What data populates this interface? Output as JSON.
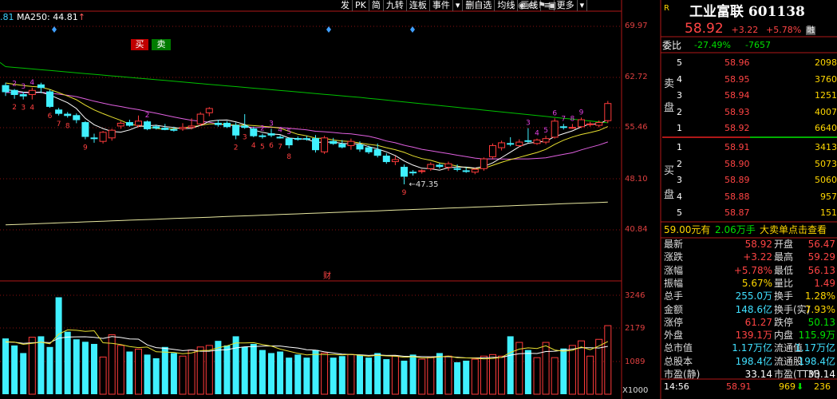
{
  "toolbar": {
    "items": [
      "发",
      "PK",
      "简",
      "九转",
      "连板",
      "事件",
      "▾",
      "删自选",
      "均线",
      "画线",
      "≡",
      "更多",
      "▾"
    ],
    "icons": [
      "search-icon",
      "eye-icon",
      "adjust-icon",
      "marker-icon",
      "save-icon"
    ]
  },
  "ma_legend": {
    "prefix": ".81",
    "ma250_label": "MA250: 44.81",
    "ma250_arrow": "↑"
  },
  "stock": {
    "r_mark": "R",
    "name": "工业富联 601138",
    "price": "58.92",
    "change": "+3.22",
    "change_pct": "+5.78%",
    "tag": "融"
  },
  "weibi": {
    "label": "委比",
    "ratio": "-27.49%",
    "diff": "-7657",
    "buy_btn": "买",
    "sell_btn": "卖"
  },
  "orderbook": {
    "sell_label_1": "卖",
    "sell_label_2": "盘",
    "buy_label_1": "买",
    "buy_label_2": "盘",
    "asks": [
      {
        "level": "5",
        "price": "58.96",
        "qty": "2098"
      },
      {
        "level": "4",
        "price": "58.95",
        "qty": "3760"
      },
      {
        "level": "3",
        "price": "58.94",
        "qty": "1251"
      },
      {
        "level": "2",
        "price": "58.93",
        "qty": "4007"
      },
      {
        "level": "1",
        "price": "58.92",
        "qty": "6640"
      }
    ],
    "bids": [
      {
        "level": "1",
        "price": "58.91",
        "qty": "3413"
      },
      {
        "level": "2",
        "price": "58.90",
        "qty": "5073"
      },
      {
        "level": "3",
        "price": "58.89",
        "qty": "5060"
      },
      {
        "level": "4",
        "price": "58.88",
        "qty": "957"
      },
      {
        "level": "5",
        "price": "58.87",
        "qty": "151"
      }
    ]
  },
  "big_order": {
    "price": "59.00元有",
    "qty": "2.06万手",
    "text": "大卖单点击查看"
  },
  "quotes": [
    {
      "l1": "最新",
      "v1": "58.92",
      "c1": "red",
      "l2": "开盘",
      "v2": "56.47",
      "c2": "red"
    },
    {
      "l1": "涨跌",
      "v1": "+3.22",
      "c1": "red",
      "l2": "最高",
      "v2": "59.29",
      "c2": "red"
    },
    {
      "l1": "涨幅",
      "v1": "+5.78%",
      "c1": "red",
      "l2": "最低",
      "v2": "56.13",
      "c2": "red"
    },
    {
      "l1": "振幅",
      "v1": "5.67%",
      "c1": "yellow",
      "l2": "量比",
      "v2": "1.49",
      "c2": "red"
    },
    {
      "l1": "总手",
      "v1": "255.0万",
      "c1": "cyan",
      "l2": "换手",
      "v2": "1.28%",
      "c2": "yellow"
    },
    {
      "l1": "金额",
      "v1": "148.6亿",
      "c1": "cyan",
      "l2": "换手(实)",
      "v2": "7.93%",
      "c2": "yellow"
    },
    {
      "l1": "涨停",
      "v1": "61.27",
      "c1": "red",
      "l2": "跌停",
      "v2": "50.13",
      "c2": "green"
    },
    {
      "l1": "外盘",
      "v1": "139.1万",
      "c1": "red",
      "l2": "内盘",
      "v2": "115.9万",
      "c2": "green"
    },
    {
      "l1": "总市值",
      "v1": "1.17万亿",
      "c1": "cyan",
      "l2": "流通值",
      "v2": "1.17万亿",
      "c2": "cyan"
    },
    {
      "l1": "总股本",
      "v1": "198.4亿",
      "c1": "cyan",
      "l2": "流通股",
      "v2": "198.4亿",
      "c2": "cyan"
    },
    {
      "l1": "市盈(静)",
      "v1": "33.14",
      "c1": "white",
      "l2": "市盈(TTM)",
      "v2": "33.14",
      "c2": "white"
    }
  ],
  "tick": {
    "time": "14:56",
    "price": "58.91",
    "qty": "969",
    "arrow": "⬇",
    "extra": "236"
  },
  "price_axis": [
    "69.97",
    "62.72",
    "55.46",
    "48.10",
    "40.84"
  ],
  "vol_axis": [
    "3246",
    "2179",
    "1089"
  ],
  "vol_unit": "X1000",
  "finance_mark": "财",
  "low_annotation": "←47.35",
  "chart_data": {
    "type": "candlestick",
    "price_ylim": [
      40.84,
      69.97
    ],
    "volume_ylim": [
      0,
      3246
    ],
    "candles": [
      {
        "o": 61.5,
        "h": 61.9,
        "l": 60.0,
        "c": 60.6
      },
      {
        "o": 60.8,
        "h": 61.0,
        "l": 59.6,
        "c": 60.2
      },
      {
        "o": 60.2,
        "h": 60.6,
        "l": 59.5,
        "c": 60.0
      },
      {
        "o": 60.2,
        "h": 61.2,
        "l": 59.5,
        "c": 60.8
      },
      {
        "o": 61.6,
        "h": 61.9,
        "l": 60.4,
        "c": 61.2
      },
      {
        "o": 60.6,
        "h": 60.9,
        "l": 58.3,
        "c": 58.5
      },
      {
        "o": 58.0,
        "h": 58.3,
        "l": 57.2,
        "c": 57.5
      },
      {
        "o": 57.4,
        "h": 57.7,
        "l": 56.9,
        "c": 57.2
      },
      {
        "o": 57.2,
        "h": 57.5,
        "l": 56.1,
        "c": 56.6
      },
      {
        "o": 56.2,
        "h": 56.4,
        "l": 53.8,
        "c": 54.2
      },
      {
        "o": 54.0,
        "h": 54.6,
        "l": 53.3,
        "c": 53.9
      },
      {
        "o": 53.5,
        "h": 55.0,
        "l": 53.2,
        "c": 54.8
      },
      {
        "o": 54.0,
        "h": 55.3,
        "l": 53.6,
        "c": 55.1
      },
      {
        "o": 55.7,
        "h": 56.4,
        "l": 55.3,
        "c": 56.1
      },
      {
        "o": 56.2,
        "h": 56.6,
        "l": 55.6,
        "c": 55.8
      },
      {
        "o": 55.8,
        "h": 57.2,
        "l": 55.5,
        "c": 56.4
      },
      {
        "o": 56.3,
        "h": 56.5,
        "l": 55.1,
        "c": 55.3
      },
      {
        "o": 55.6,
        "h": 55.9,
        "l": 55.2,
        "c": 55.4
      },
      {
        "o": 55.4,
        "h": 56.0,
        "l": 55.1,
        "c": 55.2
      },
      {
        "o": 55.2,
        "h": 55.6,
        "l": 54.9,
        "c": 55.1
      },
      {
        "o": 55.3,
        "h": 56.1,
        "l": 55.0,
        "c": 55.5
      },
      {
        "o": 55.5,
        "h": 56.8,
        "l": 55.2,
        "c": 55.7
      },
      {
        "o": 56.0,
        "h": 57.7,
        "l": 55.7,
        "c": 57.4
      },
      {
        "o": 57.6,
        "h": 58.4,
        "l": 57.1,
        "c": 58.2
      },
      {
        "o": 56.1,
        "h": 56.6,
        "l": 55.6,
        "c": 55.9
      },
      {
        "o": 56.1,
        "h": 56.4,
        "l": 55.4,
        "c": 55.6
      },
      {
        "o": 55.8,
        "h": 56.2,
        "l": 53.8,
        "c": 54.4
      },
      {
        "o": 55.7,
        "h": 57.4,
        "l": 55.3,
        "c": 55.5
      },
      {
        "o": 55.3,
        "h": 55.6,
        "l": 54.1,
        "c": 54.3
      },
      {
        "o": 54.3,
        "h": 54.6,
        "l": 53.9,
        "c": 54.2
      },
      {
        "o": 54.6,
        "h": 55.3,
        "l": 54.1,
        "c": 54.4
      },
      {
        "o": 54.1,
        "h": 54.4,
        "l": 53.9,
        "c": 54.0
      },
      {
        "o": 53.9,
        "h": 54.1,
        "l": 52.5,
        "c": 53.0
      },
      {
        "o": 53.9,
        "h": 54.2,
        "l": 53.6,
        "c": 53.8
      },
      {
        "o": 53.9,
        "h": 54.3,
        "l": 53.6,
        "c": 53.8
      },
      {
        "o": 53.9,
        "h": 54.4,
        "l": 51.9,
        "c": 52.3
      },
      {
        "o": 52.0,
        "h": 54.3,
        "l": 51.7,
        "c": 54.0
      },
      {
        "o": 53.5,
        "h": 54.0,
        "l": 53.0,
        "c": 53.2
      },
      {
        "o": 53.1,
        "h": 53.7,
        "l": 52.5,
        "c": 52.7
      },
      {
        "o": 52.9,
        "h": 53.9,
        "l": 52.3,
        "c": 53.5
      },
      {
        "o": 53.0,
        "h": 53.5,
        "l": 52.0,
        "c": 52.4
      },
      {
        "o": 52.6,
        "h": 52.9,
        "l": 51.7,
        "c": 52.0
      },
      {
        "o": 52.3,
        "h": 53.2,
        "l": 51.2,
        "c": 51.5
      },
      {
        "o": 51.4,
        "h": 51.8,
        "l": 50.3,
        "c": 50.6
      },
      {
        "o": 50.6,
        "h": 51.4,
        "l": 50.1,
        "c": 50.9
      },
      {
        "o": 49.8,
        "h": 50.2,
        "l": 47.35,
        "c": 48.5
      },
      {
        "o": 49.1,
        "h": 49.4,
        "l": 48.6,
        "c": 49.0
      },
      {
        "o": 49.2,
        "h": 49.5,
        "l": 48.9,
        "c": 49.3
      },
      {
        "o": 49.6,
        "h": 50.5,
        "l": 49.3,
        "c": 50.2
      },
      {
        "o": 50.1,
        "h": 50.4,
        "l": 49.6,
        "c": 49.9
      },
      {
        "o": 49.8,
        "h": 50.6,
        "l": 49.3,
        "c": 50.3
      },
      {
        "o": 49.6,
        "h": 50.2,
        "l": 49.2,
        "c": 49.5
      },
      {
        "o": 49.3,
        "h": 49.8,
        "l": 49.0,
        "c": 49.2
      },
      {
        "o": 49.1,
        "h": 49.7,
        "l": 48.8,
        "c": 49.5
      },
      {
        "o": 49.6,
        "h": 51.2,
        "l": 49.3,
        "c": 51.0
      },
      {
        "o": 51.3,
        "h": 53.2,
        "l": 51.0,
        "c": 52.9
      },
      {
        "o": 52.6,
        "h": 53.6,
        "l": 52.2,
        "c": 53.3
      },
      {
        "o": 53.2,
        "h": 54.1,
        "l": 52.8,
        "c": 53.1
      },
      {
        "o": 52.9,
        "h": 53.8,
        "l": 52.7,
        "c": 53.4
      },
      {
        "o": 53.6,
        "h": 55.4,
        "l": 53.3,
        "c": 53.5
      },
      {
        "o": 53.2,
        "h": 53.9,
        "l": 53.0,
        "c": 53.7
      },
      {
        "o": 53.4,
        "h": 54.3,
        "l": 53.1,
        "c": 53.9
      },
      {
        "o": 54.1,
        "h": 56.8,
        "l": 53.9,
        "c": 56.4
      },
      {
        "o": 55.6,
        "h": 56.0,
        "l": 55.2,
        "c": 55.5
      },
      {
        "o": 55.5,
        "h": 56.0,
        "l": 55.3,
        "c": 55.5
      },
      {
        "o": 55.6,
        "h": 56.9,
        "l": 55.4,
        "c": 56.6
      },
      {
        "o": 55.9,
        "h": 56.3,
        "l": 55.6,
        "c": 56.0
      },
      {
        "o": 55.8,
        "h": 56.5,
        "l": 55.5,
        "c": 56.2
      },
      {
        "o": 56.47,
        "h": 59.29,
        "l": 56.13,
        "c": 58.92
      }
    ],
    "volume": [
      1830,
      1600,
      1350,
      1870,
      1900,
      1550,
      3180,
      2050,
      1800,
      1720,
      1650,
      1220,
      1950,
      1600,
      1400,
      1480,
      1300,
      1180,
      1550,
      1350,
      1250,
      1450,
      1550,
      1600,
      1750,
      1600,
      1900,
      1550,
      1650,
      1450,
      1350,
      1400,
      1200,
      1300,
      1200,
      1450,
      1350,
      1200,
      1250,
      1300,
      1280,
      1200,
      1350,
      1150,
      1250,
      1100,
      1300,
      1150,
      1200,
      1350,
      1250,
      1050,
      1100,
      1150,
      1250,
      1300,
      1250,
      1900,
      1700,
      1450,
      1200,
      1700,
      1200,
      1500,
      1600,
      1750,
      1250,
      1800,
      2250
    ],
    "td_counts_up": [
      {
        "i": 1,
        "n": "2"
      },
      {
        "i": 2,
        "n": "3"
      },
      {
        "i": 3,
        "n": "4"
      },
      {
        "i": 5,
        "n": "6"
      },
      {
        "i": 6,
        "n": "7"
      },
      {
        "i": 7,
        "n": "8"
      },
      {
        "i": 9,
        "n": "9"
      },
      {
        "i": 26,
        "n": "2"
      },
      {
        "i": 27,
        "n": "3"
      },
      {
        "i": 28,
        "n": "4"
      },
      {
        "i": 29,
        "n": "5"
      },
      {
        "i": 30,
        "n": "6"
      },
      {
        "i": 31,
        "n": "7"
      },
      {
        "i": 32,
        "n": "8"
      },
      {
        "i": 45,
        "n": "9"
      }
    ],
    "td_counts_down": [
      {
        "i": 1,
        "n": "2"
      },
      {
        "i": 2,
        "n": "3"
      },
      {
        "i": 3,
        "n": "4"
      },
      {
        "i": 16,
        "n": "2"
      },
      {
        "i": 29,
        "n": "2"
      },
      {
        "i": 30,
        "n": "3"
      },
      {
        "i": 31,
        "n": "4"
      },
      {
        "i": 32,
        "n": "5"
      },
      {
        "i": 59,
        "n": "3"
      },
      {
        "i": 60,
        "n": "4"
      },
      {
        "i": 61,
        "n": "5"
      },
      {
        "i": 62,
        "n": "6"
      },
      {
        "i": 63,
        "n": "7"
      },
      {
        "i": 64,
        "n": "8"
      },
      {
        "i": 65,
        "n": "9"
      }
    ],
    "ma_series": [
      {
        "color": "#ffffff"
      },
      {
        "color": "#e8e030"
      },
      {
        "color": "#e060e0"
      },
      {
        "color": "#00c000"
      },
      {
        "color": "#e8e8a0"
      }
    ],
    "colors": {
      "up": "#ff3b3b",
      "down": "#40f0ff",
      "grid": "#8a1010",
      "tdup": "#ff4040",
      "tddown": "#e040e0"
    }
  }
}
